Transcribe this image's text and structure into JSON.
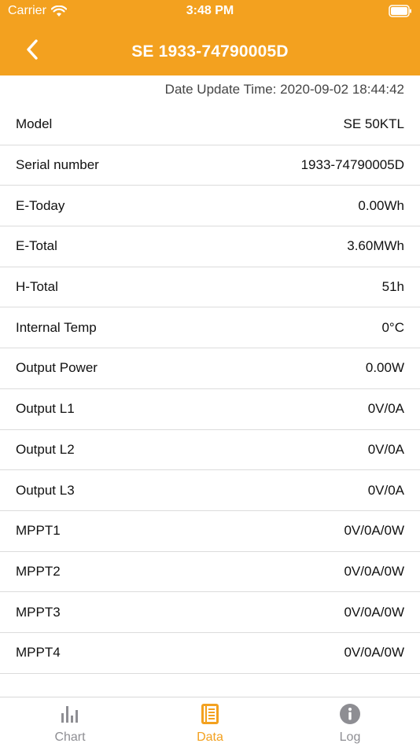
{
  "status_bar": {
    "carrier": "Carrier",
    "time": "3:48 PM"
  },
  "nav": {
    "title": "SE 1933-74790005D"
  },
  "update_time": "Date Update Time: 2020-09-02 18:44:42",
  "rows": [
    {
      "label": "Model",
      "value": "SE 50KTL"
    },
    {
      "label": "Serial number",
      "value": "1933-74790005D"
    },
    {
      "label": "E-Today",
      "value": "0.00Wh"
    },
    {
      "label": "E-Total",
      "value": "3.60MWh"
    },
    {
      "label": "H-Total",
      "value": "51h"
    },
    {
      "label": "Internal Temp",
      "value": "0°C"
    },
    {
      "label": "Output Power",
      "value": "0.00W"
    },
    {
      "label": "Output L1",
      "value": "0V/0A"
    },
    {
      "label": "Output L2",
      "value": "0V/0A"
    },
    {
      "label": "Output L3",
      "value": "0V/0A"
    },
    {
      "label": "MPPT1",
      "value": "0V/0A/0W"
    },
    {
      "label": "MPPT2",
      "value": "0V/0A/0W"
    },
    {
      "label": "MPPT3",
      "value": "0V/0A/0W"
    },
    {
      "label": "MPPT4",
      "value": "0V/0A/0W"
    }
  ],
  "tabs": [
    {
      "label": "Chart",
      "icon": "bar-chart-icon",
      "active": false
    },
    {
      "label": "Data",
      "icon": "document-list-icon",
      "active": true
    },
    {
      "label": "Log",
      "icon": "info-icon",
      "active": false
    }
  ],
  "colors": {
    "accent": "#f3a11f",
    "inactive": "#8e8e93",
    "divider": "#dcdcdc"
  }
}
